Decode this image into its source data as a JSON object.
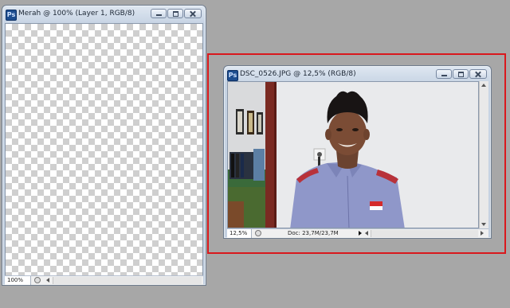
{
  "windows": [
    {
      "id": "merah",
      "title": "Merah @ 100% (Layer 1, RGB/8)",
      "app_icon": "Ps",
      "zoom": "100%",
      "canvas": "transparent-checkerboard"
    },
    {
      "id": "dsc",
      "title": "DSC_0526.JPG @ 12,5% (RGB/8)",
      "app_icon": "Ps",
      "zoom": "12,5%",
      "doc_info": "Doc: 23,7M/23,7M",
      "canvas": "photo"
    }
  ],
  "highlight": {
    "color": "#d9181d"
  },
  "colors": {
    "workspace": "#a7a7a7"
  }
}
